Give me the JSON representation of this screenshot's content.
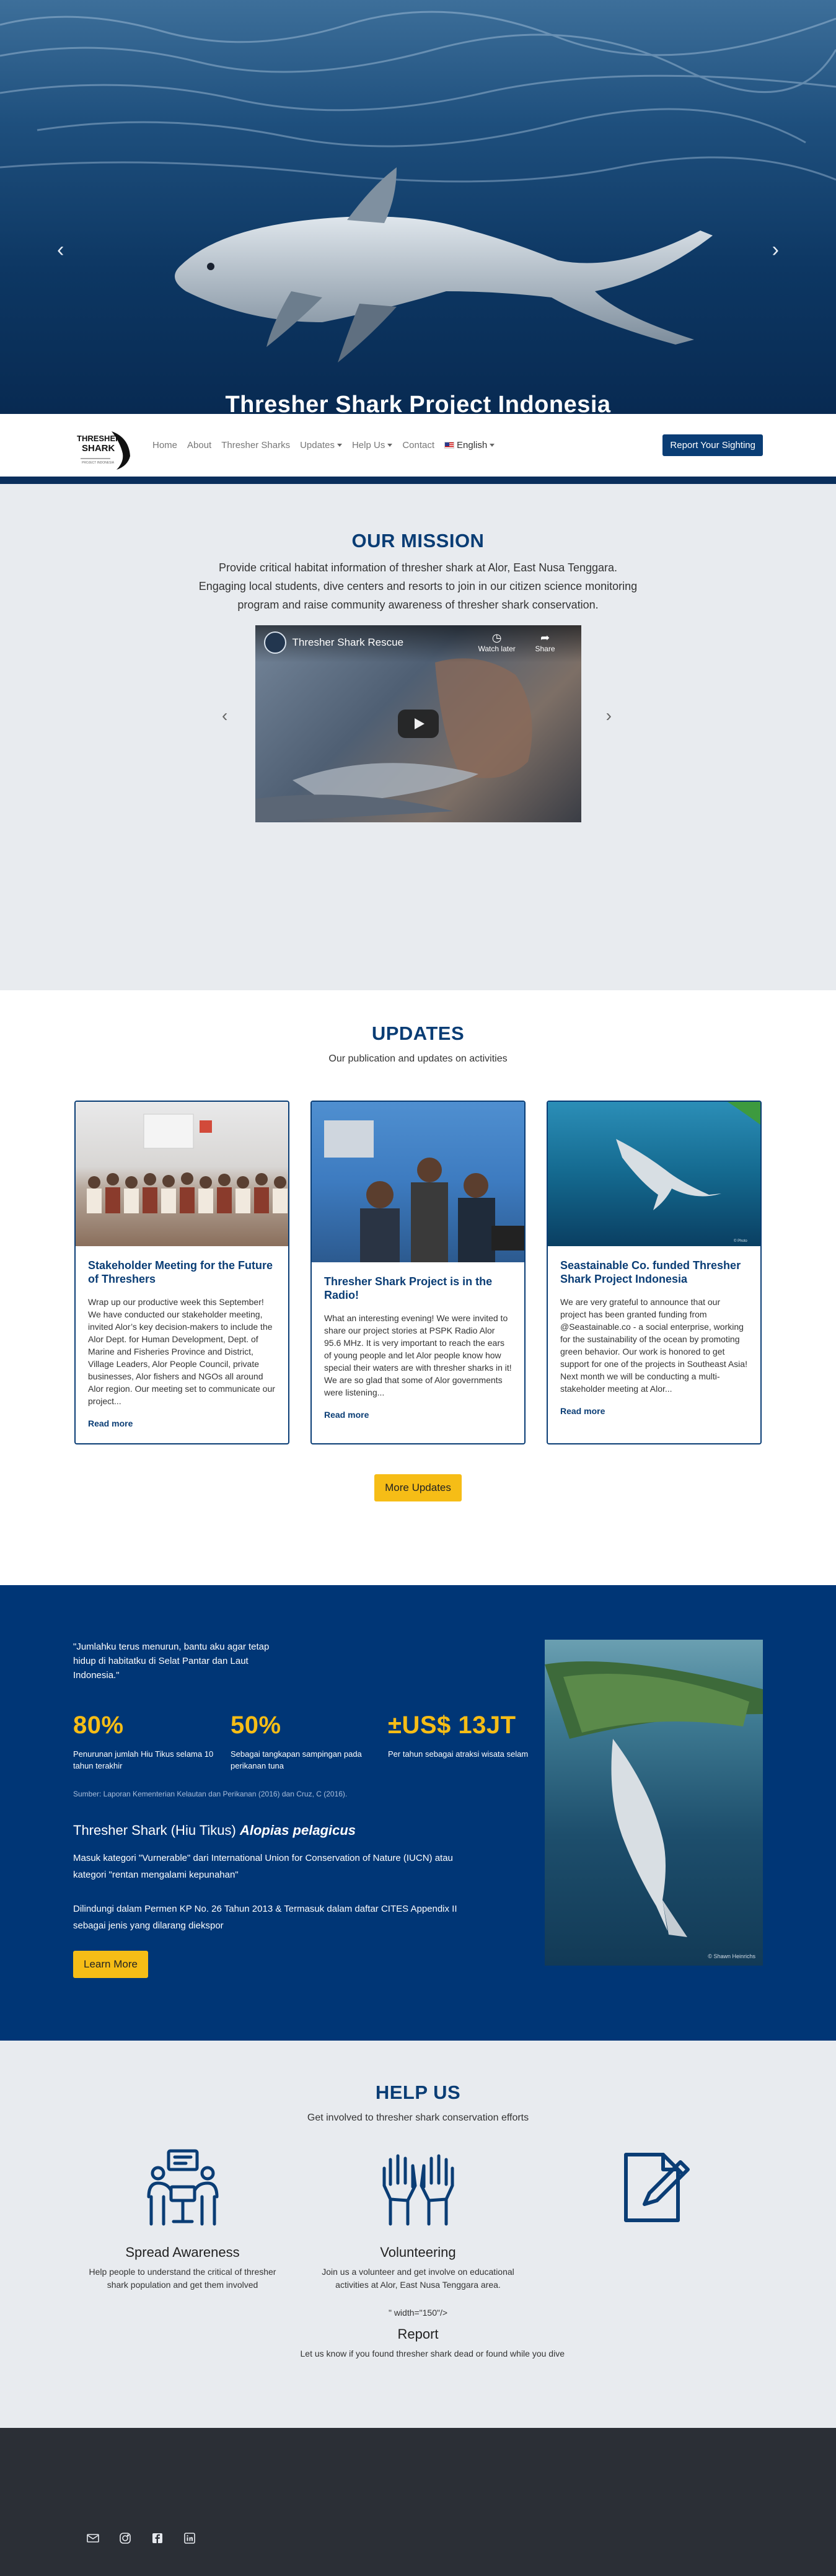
{
  "hero": {
    "title": "Thresher Shark Project Indonesia"
  },
  "nav": {
    "logo_alt": "Thresher Shark",
    "items": [
      {
        "label": "Home"
      },
      {
        "label": "About"
      },
      {
        "label": "Thresher Sharks"
      },
      {
        "label": "Updates",
        "dropdown": true
      },
      {
        "label": "Help Us",
        "dropdown": true
      },
      {
        "label": "Contact"
      },
      {
        "label": "English",
        "dropdown": true
      }
    ],
    "report_label": "Report Your Sighting"
  },
  "mission": {
    "title": "OUR MISSION",
    "text": "Provide critical habitat information of thresher shark at Alor, East Nusa Tenggara. Engaging local students, dive centers and resorts to join in our citizen science monitoring program and raise community awareness of thresher shark conservation.",
    "video": {
      "title": "Thresher Shark Rescue",
      "watch_later": "Watch later",
      "share": "Share"
    }
  },
  "updates": {
    "title": "UPDATES",
    "subtitle": "Our publication and updates on activities",
    "cards": [
      {
        "title": "Stakeholder Meeting for the Future of Threshers",
        "text": "Wrap up our productive week this September! We have conducted our stakeholder meeting, invited Alor’s key decision-makers to include the Alor Dept. for Human Development, Dept. of Marine and Fisheries Province and District, Village Leaders, Alor People Council, private businesses, Alor fishers and NGOs all around Alor region. Our meeting set to communicate our project...",
        "link": "Read more"
      },
      {
        "title": "Thresher Shark Project is in the Radio!",
        "text": "What an interesting evening! We were invited to share our project stories at PSPK Radio Alor 95.6 MHz. It is very important to reach the ears of young people and let Alor people know how special their waters are with thresher sharks in it! We are so glad that some of Alor governments were listening...",
        "link": "Read more"
      },
      {
        "title": "Seastainable Co. funded Thresher Shark Project Indonesia",
        "text": "We are very grateful to announce that our project has been granted funding from @Seastainable.co - a social enterprise, working for the sustainability of the ocean by promoting green behavior. Our work is honored to get support for one of the projects in Southeast Asia! Next month we will be conducting a multi-stakeholder meeting at Alor...",
        "link": "Read more"
      }
    ],
    "more_label": "More Updates"
  },
  "stats": {
    "quote": "\"Jumlahku terus menurun, bantu aku agar tetap hidup di habitatku di Selat Pantar dan Laut Indonesia.\"",
    "items": [
      {
        "number": "80%",
        "desc": "Penurunan jumlah Hiu Tikus selama 10 tahun terakhir"
      },
      {
        "number": "50%",
        "desc": "Sebagai tangkapan sampingan pada perikanan tuna"
      },
      {
        "number": "±US$ 13JT",
        "desc": "Per tahun sebagai atraksi wisata selam"
      }
    ],
    "source": "Sumber: Laporan Kementerian Kelautan dan Perikanan (2016) dan Cruz, C (2016).",
    "species_plain": "Thresher Shark (Hiu Tikus)",
    "species_latin": "Alopias pelagicus",
    "status1": "Masuk kategori \"Vurnerable\" dari International Union for Conservation of Nature (IUCN) atau kategori \"rentan mengalami kepunahan\"",
    "status2": "Dilindungi dalam Permen KP No. 26 Tahun 2013 & Termasuk dalam daftar CITES Appendix II sebagai jenis yang dilarang diekspor",
    "learn_label": "Learn More",
    "photo_credit": "© Shawn Heinrichs"
  },
  "help": {
    "title": "HELP US",
    "subtitle": "Get involved to thresher shark conservation efforts",
    "items": [
      {
        "name": "Spread Awareness",
        "desc": "Help people to understand the critical of thresher shark population and get them involved",
        "icon": "presentation-icon"
      },
      {
        "name": "Volunteering",
        "desc": "Join us a volunteer and get involve on educational activities at Alor, East Nusa Tenggara area.",
        "icon": "raised-hands-icon"
      },
      {
        "name": "Report",
        "desc": "Let us know if you found thresher shark dead or found while you dive",
        "icon": "report-pen-icon"
      }
    ],
    "stray_text": "\" width=\"150\"/>"
  },
  "footer": {
    "socials": [
      "mail-icon",
      "instagram-icon",
      "facebook-icon",
      "linkedin-icon"
    ]
  },
  "colors": {
    "primary": "#0a3d75",
    "accent": "#f6bd16",
    "stats_bg": "#003676",
    "light_bg": "#e8ebef",
    "footer_bg": "#2b2f36"
  }
}
